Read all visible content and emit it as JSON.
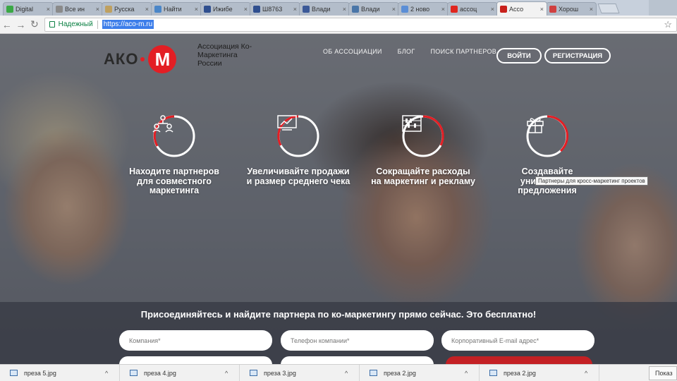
{
  "browser": {
    "tabs": [
      {
        "label": "Digital",
        "color": "#3aa845",
        "active": false
      },
      {
        "label": "Все ин",
        "color": "#8a8a8a",
        "active": false
      },
      {
        "label": "Русска",
        "color": "#bfa060",
        "active": false
      },
      {
        "label": "Найти",
        "color": "#4a86c8",
        "active": false
      },
      {
        "label": "Ижибе",
        "color": "#2f4f8f",
        "active": false
      },
      {
        "label": "Ш8763",
        "color": "#2f4f8f",
        "active": false
      },
      {
        "label": "Влади",
        "color": "#3b5998",
        "active": false
      },
      {
        "label": "Влади",
        "color": "#4a76a8",
        "active": false
      },
      {
        "label": "2 ново",
        "color": "#5b8ed6",
        "active": false
      },
      {
        "label": "ассоц",
        "color": "#e0261f",
        "active": false
      },
      {
        "label": "Ассо",
        "color": "#c8211c",
        "active": true
      },
      {
        "label": "Хорош",
        "color": "#d04040",
        "active": false
      }
    ],
    "close_glyph": "×",
    "address": {
      "secure_label": "Надежный",
      "url": "https://aco-m.ru"
    }
  },
  "site": {
    "logo_text": "АКО",
    "logo_mark": "М",
    "logo_subtitle": "Ассоциация Ко-Маркетинга России",
    "nav": {
      "links": [
        "ОБ АССОЦИАЦИИ",
        "БЛОГ",
        "ПОИСК ПАРТНЕРОВ"
      ],
      "login": "ВОЙТИ",
      "register": "РЕГИСТРАЦИЯ"
    },
    "features": [
      {
        "text": "Находите партнеров для совместного маркетинга",
        "icon": "people-network-icon"
      },
      {
        "text": "Увеличивайте продажи и размер среднего чека",
        "icon": "chart-icon"
      },
      {
        "text": "Сокращайте расходы на маркетинг и рекламу",
        "icon": "abacus-icon"
      },
      {
        "text": "Создавайте уникальные предложения",
        "icon": "gift-icon"
      }
    ],
    "tooltip": "Партнеры для кросс-маркетинг проектов",
    "join": {
      "title": "Присоединяйтесь и найдите партнера по ко-маркетингу прямо сейчас. Это бесплатно!",
      "fields": [
        {
          "placeholder": "Компания*"
        },
        {
          "placeholder": "Телефон компании*"
        },
        {
          "placeholder": "Корпоративный E-mail адрес*"
        }
      ]
    },
    "accent_color": "#e31e24"
  },
  "downloads": {
    "items": [
      "преза 5.jpg",
      "преза 4.jpg",
      "преза 3.jpg",
      "преза 2.jpg",
      "преза 2.jpg"
    ],
    "show_all": "Показ"
  }
}
